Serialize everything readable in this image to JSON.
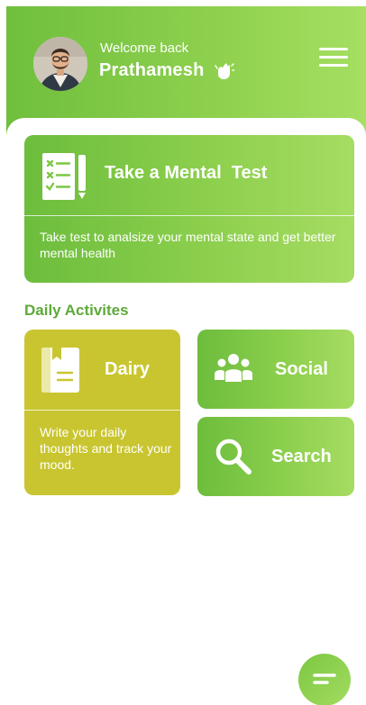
{
  "header": {
    "welcome_text": "Welcome back",
    "user_name": "Prathamesh"
  },
  "test_card": {
    "title": "Take a Mental  Test",
    "description": "Take test to analsize your mental state and get better mental health"
  },
  "section": {
    "title": "Daily Activites"
  },
  "diary_card": {
    "title": "Dairy",
    "description": "Write your daily thoughts and track your mood."
  },
  "social_card": {
    "title": "Social"
  },
  "search_card": {
    "title": "Search"
  },
  "colors": {
    "primary_green": "#7cc742",
    "accent_yellow_green": "#c9c530",
    "section_title": "#5fa93a"
  },
  "icons": {
    "avatar": "user-avatar",
    "wave": "waving-hand-icon",
    "menu": "hamburger-menu-icon",
    "test": "checklist-icon",
    "diary": "book-icon",
    "social": "people-group-icon",
    "search": "magnifier-icon",
    "chat": "chat-bubble-icon"
  }
}
